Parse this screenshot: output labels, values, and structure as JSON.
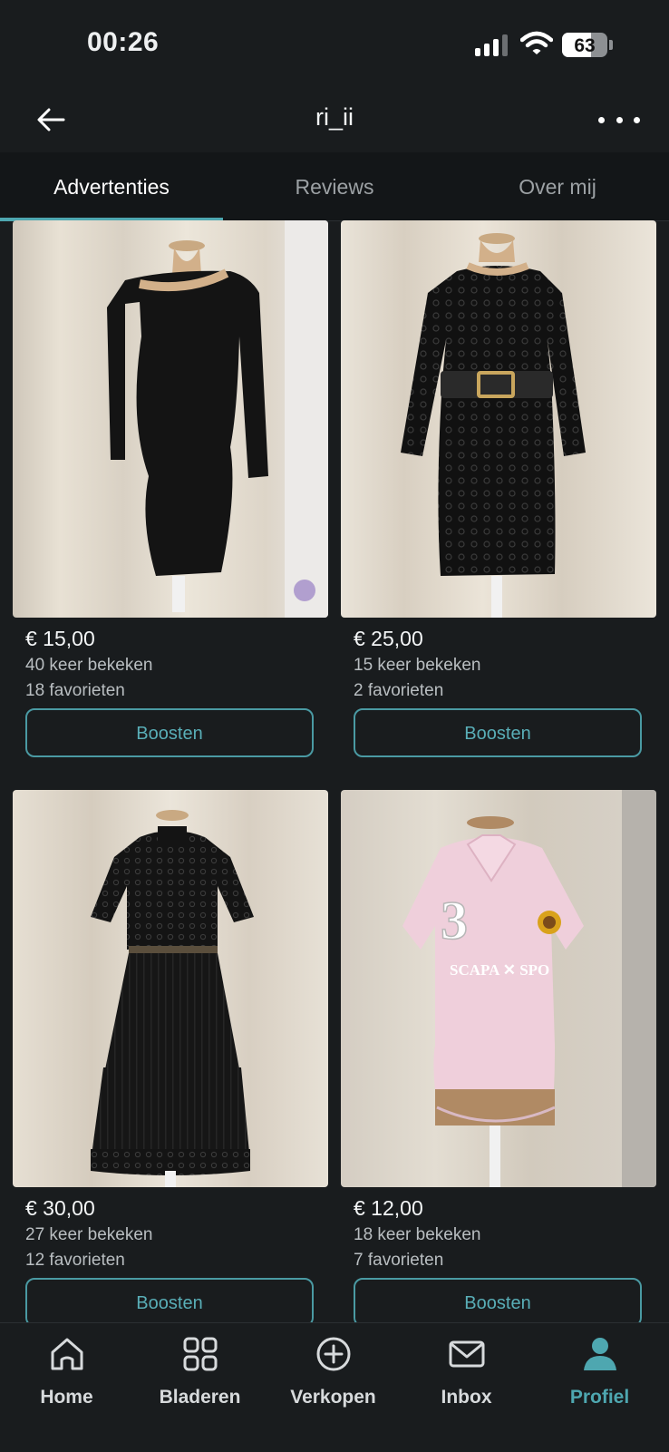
{
  "status_bar": {
    "time": "00:26",
    "battery_percent": "63",
    "battery_level": 0.63,
    "signal_bars_active": 3
  },
  "header": {
    "title": "ri_ii",
    "back_icon": "arrow-left-icon",
    "more_icon": "more-horizontal-icon"
  },
  "tabs": [
    {
      "label": "Advertenties",
      "active": true
    },
    {
      "label": "Reviews",
      "active": false
    },
    {
      "label": "Over mij",
      "active": false
    }
  ],
  "listings": [
    {
      "price": "€ 15,00",
      "views": "40 keer bekeken",
      "favorites": "18 favorieten",
      "button": "Boosten",
      "image": "black one-shoulder ribbed dress on mannequin"
    },
    {
      "price": "€ 25,00",
      "views": "15 keer bekeken",
      "favorites": "2 favorieten",
      "button": "Boosten",
      "image": "black lace dress with wide belt on mannequin"
    },
    {
      "price": "€ 30,00",
      "views": "27 keer bekeken",
      "favorites": "12 favorieten",
      "button": "Boosten",
      "image": "black lace pleated dress on mannequin"
    },
    {
      "price": "€ 12,00",
      "views": "18 keer bekeken",
      "favorites": "7 favorieten",
      "button": "Boosten",
      "image": "pink polo shirt on mannequin"
    }
  ],
  "bottom_nav": [
    {
      "label": "Home",
      "icon": "home-icon",
      "active": false
    },
    {
      "label": "Bladeren",
      "icon": "grid-icon",
      "active": false
    },
    {
      "label": "Verkopen",
      "icon": "plus-circle-icon",
      "active": false
    },
    {
      "label": "Inbox",
      "icon": "mail-icon",
      "active": false
    },
    {
      "label": "Profiel",
      "icon": "profile-icon",
      "active": true
    }
  ],
  "colors": {
    "background": "#191c1e",
    "accent": "#4ea7b0"
  }
}
